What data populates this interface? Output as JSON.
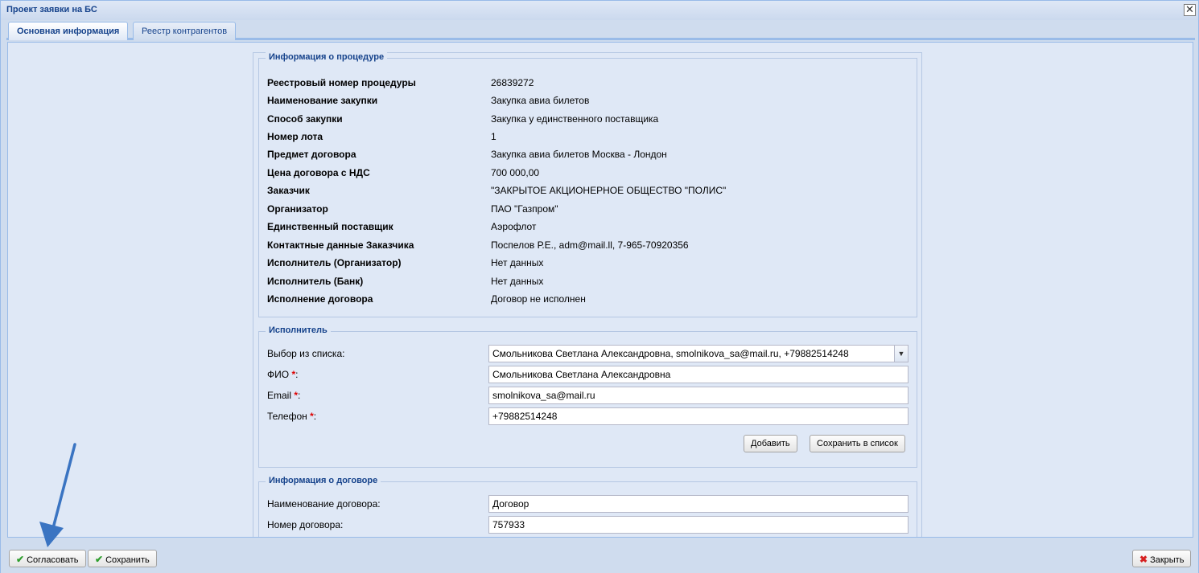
{
  "window": {
    "title": "Проект заявки на БС",
    "close_glyph": "✕"
  },
  "tabs": [
    {
      "label": "Основная информация",
      "active": true
    },
    {
      "label": "Реестр контрагентов",
      "active": false
    }
  ],
  "procedure": {
    "legend": "Информация о процедуре",
    "rows": [
      {
        "label": "Реестровый номер процедуры",
        "value": "26839272"
      },
      {
        "label": "Наименование закупки",
        "value": "Закупка авиа билетов"
      },
      {
        "label": "Способ закупки",
        "value": "Закупка у единственного поставщика"
      },
      {
        "label": "Номер лота",
        "value": "1"
      },
      {
        "label": "Предмет договора",
        "value": "Закупка авиа билетов Москва - Лондон"
      },
      {
        "label": "Цена договора с НДС",
        "value": "700 000,00"
      },
      {
        "label": "Заказчик",
        "value": "\"ЗАКРЫТОЕ АКЦИОНЕРНОЕ ОБЩЕСТВО \"ПОЛИС\""
      },
      {
        "label": "Организатор",
        "value": "ПАО \"Газпром\""
      },
      {
        "label": "Единственный поставщик",
        "value": "Аэрофлот"
      },
      {
        "label": "Контактные данные Заказчика",
        "value": "Поспелов Р.Е., adm@mail.ll, 7-965-70920356"
      },
      {
        "label": "Исполнитель (Организатор)",
        "value": "Нет данных"
      },
      {
        "label": "Исполнитель (Банк)",
        "value": "Нет данных"
      },
      {
        "label": "Исполнение договора",
        "value": "Договор не исполнен"
      }
    ]
  },
  "executor": {
    "legend": "Исполнитель",
    "select_label": "Выбор из списка:",
    "select_value": "Смольникова Светлана Александровна, smolnikova_sa@mail.ru, +79882514248",
    "fio_label": "ФИО",
    "fio_value": "Смольникова Светлана Александровна",
    "email_label": "Email",
    "email_value": "smolnikova_sa@mail.ru",
    "phone_label": "Телефон",
    "phone_value": "+79882514248",
    "required_mark": "*",
    "colon": ":",
    "add_button": "Добавить",
    "save_to_list_button": "Сохранить в список"
  },
  "contract": {
    "legend": "Информация о договоре",
    "name_label": "Наименование договора:",
    "name_value": "Договор",
    "number_label": "Номер договора:",
    "number_value": "757933"
  },
  "footer": {
    "approve_button": "Согласовать",
    "save_button": "Сохранить",
    "close_button": "Закрыть"
  },
  "colors": {
    "accent": "#15428b",
    "approve_icon": "#2e9e2e",
    "close_icon": "#d62020",
    "annotation_arrow": "#3a74c2"
  }
}
